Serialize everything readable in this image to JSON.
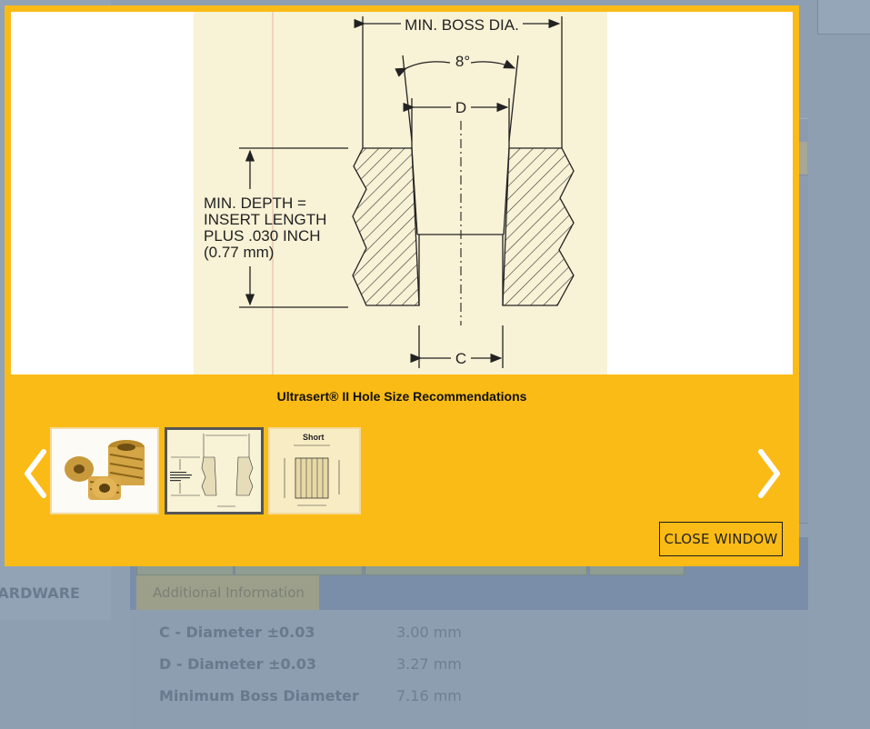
{
  "background": {
    "sidebar_item": "HARDWARE",
    "tab_additional": "Additional Information",
    "specs": [
      {
        "label": "C - Diameter ±0.03",
        "value": "3.00 mm"
      },
      {
        "label": "D - Diameter ±0.03",
        "value": "3.27 mm"
      },
      {
        "label": "Minimum Boss Diameter",
        "value": "7.16 mm"
      }
    ]
  },
  "modal": {
    "drawing": {
      "boss_label": "MIN. BOSS DIA.",
      "angle_label": "8°",
      "d_label": "D",
      "c_label": "C",
      "depth_lines": [
        "MIN. DEPTH =",
        "INSERT LENGTH",
        "PLUS .030 INCH",
        "(0.77 mm)"
      ]
    },
    "caption": "Ultrasert® II Hole Size Recommendations",
    "thumbnails": [
      {
        "name": "insert-photo"
      },
      {
        "name": "hole-size-drawing",
        "selected": true
      },
      {
        "name": "short-insert-drawing",
        "label": "Short"
      }
    ],
    "close_label": "CLOSE WINDOW",
    "prev_icon": "chevron-left-icon",
    "next_icon": "chevron-right-icon"
  },
  "colors": {
    "modal_bg": "#fbbb16",
    "overlay": "#8f9fb2"
  }
}
